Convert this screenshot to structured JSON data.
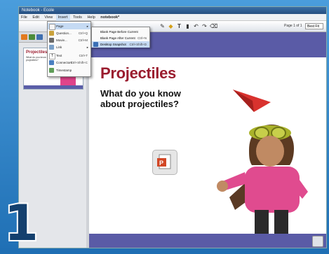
{
  "window": {
    "title": "Notebook - Ecole"
  },
  "menubar": {
    "items": [
      "File",
      "Edit",
      "View",
      "Insert",
      "Tools",
      "Help",
      "notebook*"
    ]
  },
  "toolbar": {
    "page_label": "Page 1 of 1",
    "page_box": "Best Fit"
  },
  "dropdown": {
    "items": [
      {
        "label": "Page",
        "shortcut": "",
        "submenu": true
      },
      {
        "label": "Question...",
        "shortcut": "Ctrl+Q"
      },
      {
        "label": "Movie...",
        "shortcut": "Ctrl+M"
      },
      {
        "label": "Link",
        "shortcut": "",
        "submenu": true
      },
      {
        "label": "Text",
        "shortcut": "Ctrl+T"
      },
      {
        "label": "Connectors",
        "shortcut": "Ctrl+Shift+C"
      },
      {
        "label": "Timestamp",
        "shortcut": ""
      }
    ]
  },
  "submenu": {
    "items": [
      {
        "label": "Blank Page Before Current",
        "shortcut": ""
      },
      {
        "label": "Blank Page After Current",
        "shortcut": "Ctrl+N"
      },
      {
        "label": "Desktop Snapshot",
        "shortcut": "Ctrl+Shift+D"
      }
    ]
  },
  "thumbnail": {
    "title": "Projectiles",
    "subtitle": "What do you know about projectiles?"
  },
  "slide": {
    "title": "Projectiles",
    "subtitle": "What do you know about projectiles?"
  },
  "overlay": {
    "number": "1"
  },
  "colors": {
    "accent_band": "#5a5ba6",
    "title_red": "#9a1c2e",
    "frame_blue": "#2b7fc4"
  }
}
